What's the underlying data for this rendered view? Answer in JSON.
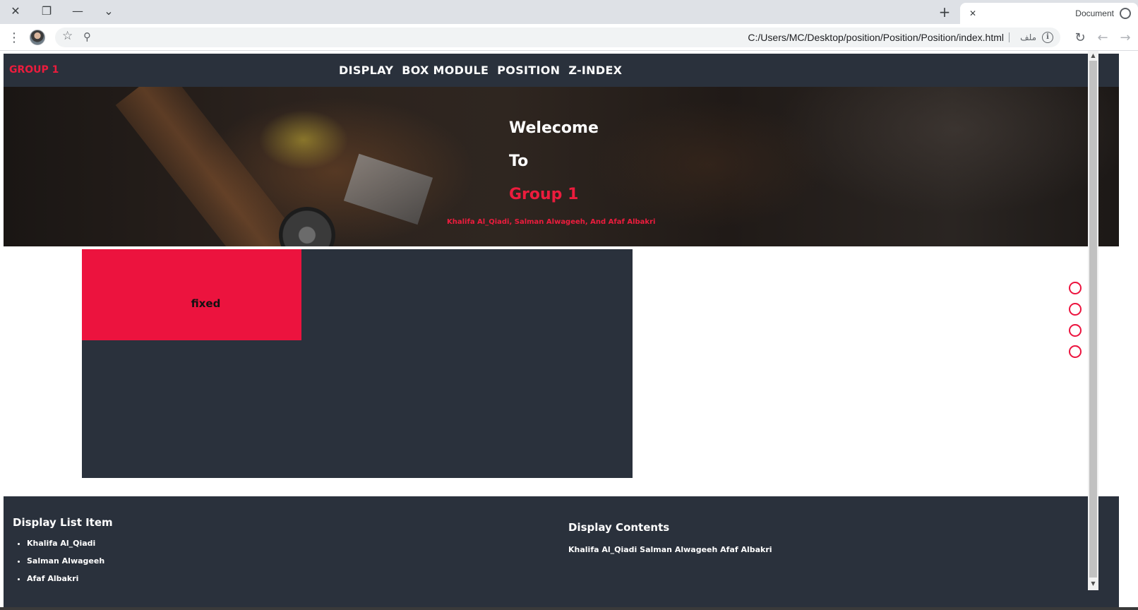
{
  "browser": {
    "tab_title": "Document",
    "url": "C:/Users/MC/Desktop/position/Position/Position/index.html",
    "file_label": "ملف"
  },
  "nav": {
    "brand": "GROUP 1",
    "links": [
      "DISPLAY",
      "BOX MODULE",
      "POSITION",
      "Z-INDEX"
    ]
  },
  "hero": {
    "line1": "Welecome",
    "line2": "To",
    "line3": "Group 1",
    "subtitle": "Khalifa Al_Qiadi, Salman Alwageeh, And Afaf Albakri"
  },
  "box": {
    "fixed_label": "fixed"
  },
  "dots": {
    "count": 4,
    "color": "#ec133e"
  },
  "footer": {
    "list_title": "Display List Item",
    "list_items": [
      "Khalifa Al_Qiadi",
      "Salman Alwageeh",
      "Afaf Albakri"
    ],
    "contents_title": "Display Contents",
    "contents_text": "Khalifa Al_Qiadi Salman Alwageeh Afaf Albakri"
  },
  "colors": {
    "accent": "#ec133e",
    "dark": "#2a313c",
    "white": "#ffffff"
  },
  "icons": [
    "close-icon",
    "restore-icon",
    "minimize-icon",
    "chevron-down-icon",
    "new-tab-icon",
    "globe-icon",
    "menu-dots-icon",
    "star-icon",
    "zoom-icon",
    "info-icon",
    "reload-icon",
    "back-icon",
    "forward-icon"
  ]
}
